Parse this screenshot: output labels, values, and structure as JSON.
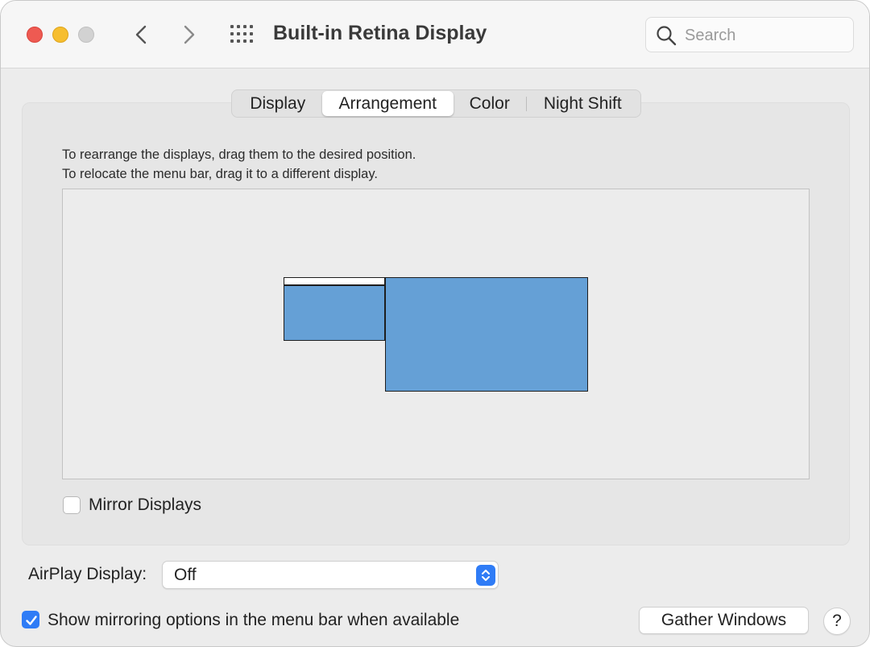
{
  "window": {
    "title": "Built-in Retina Display",
    "controls": [
      "close",
      "minimize",
      "zoom"
    ]
  },
  "toolbar": {
    "back_icon": "chevron-left-icon",
    "forward_icon": "chevron-right-icon",
    "show_all_icon": "grid-icon"
  },
  "search": {
    "placeholder": "Search",
    "value": "",
    "icon": "search-icon"
  },
  "tabs": [
    {
      "label": "Display",
      "selected": false
    },
    {
      "label": "Arrangement",
      "selected": true
    },
    {
      "label": "Color",
      "selected": false
    },
    {
      "label": "Night Shift",
      "selected": false
    }
  ],
  "arrangement": {
    "instruction_line1": "To rearrange the displays, drag them to the desired position.",
    "instruction_line2": "To relocate the menu bar, drag it to a different display.",
    "display_color": "#65a0d6",
    "mirror_displays": {
      "label": "Mirror Displays",
      "checked": false
    }
  },
  "airplay": {
    "label": "AirPlay Display:",
    "value": "Off"
  },
  "footer": {
    "show_mirroring": {
      "label": "Show mirroring options in the menu bar when available",
      "checked": true
    },
    "gather_windows_label": "Gather Windows",
    "help_label": "?"
  },
  "colors": {
    "accent": "#2f7cf6",
    "close": "#ee5a52",
    "minimize": "#f6be2f",
    "zoom_inactive": "#d2d2d2"
  }
}
